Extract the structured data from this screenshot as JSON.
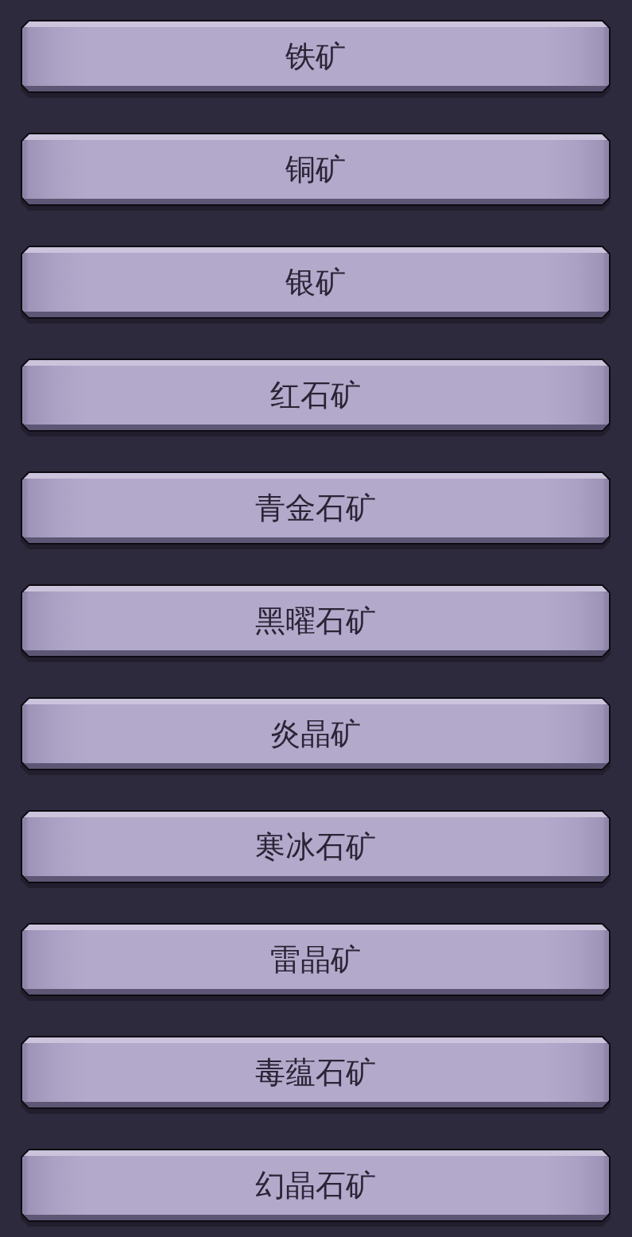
{
  "buttons": [
    {
      "label": "铁矿"
    },
    {
      "label": "铜矿"
    },
    {
      "label": "银矿"
    },
    {
      "label": "红石矿"
    },
    {
      "label": "青金石矿"
    },
    {
      "label": "黑曜石矿"
    },
    {
      "label": "炎晶矿"
    },
    {
      "label": "寒冰石矿"
    },
    {
      "label": "雷晶矿"
    },
    {
      "label": "毒蕴石矿"
    },
    {
      "label": "幻晶石矿"
    }
  ]
}
